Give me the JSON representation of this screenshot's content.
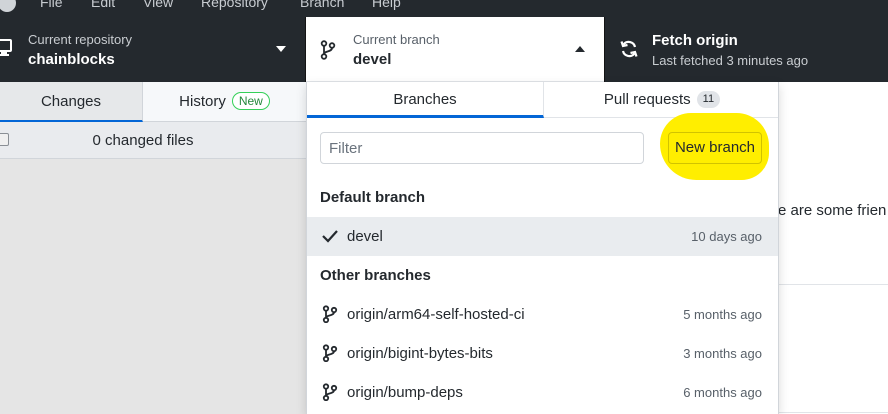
{
  "menu": {
    "items": [
      "File",
      "Edit",
      "View",
      "Repository",
      "Branch",
      "Help"
    ]
  },
  "toolbar": {
    "repository": {
      "label": "Current repository",
      "value": "chainblocks"
    },
    "branch": {
      "label": "Current branch",
      "value": "devel"
    },
    "fetch": {
      "label": "Fetch origin",
      "status": "Last fetched 3 minutes ago"
    }
  },
  "sidebar": {
    "tabs": {
      "changes": "Changes",
      "history": "History",
      "history_badge": "New"
    },
    "changed_files": "0 changed files"
  },
  "main": {
    "text": "e are some frien"
  },
  "branch_dropdown": {
    "tabs": {
      "branches": "Branches",
      "pull_requests": "Pull requests",
      "pull_requests_count": "11"
    },
    "filter_placeholder": "Filter",
    "new_branch_label": "New branch",
    "default_section": "Default branch",
    "default_branches": [
      {
        "name": "devel",
        "updated": "10 days ago",
        "selected": true
      }
    ],
    "other_section": "Other branches",
    "other_branches": [
      {
        "name": "origin/arm64-self-hosted-ci",
        "updated": "5 months ago"
      },
      {
        "name": "origin/bigint-bytes-bits",
        "updated": "3 months ago"
      },
      {
        "name": "origin/bump-deps",
        "updated": "6 months ago"
      }
    ]
  },
  "colors": {
    "toolbar_bg": "#24292e",
    "accent": "#0366d6",
    "highlight": "#ffee00",
    "new_badge": "#22863a"
  },
  "icons": [
    "app-logo-icon",
    "desktop-icon",
    "branch-icon",
    "chevron-down-icon",
    "chevron-up-icon",
    "sync-icon",
    "check-icon"
  ]
}
